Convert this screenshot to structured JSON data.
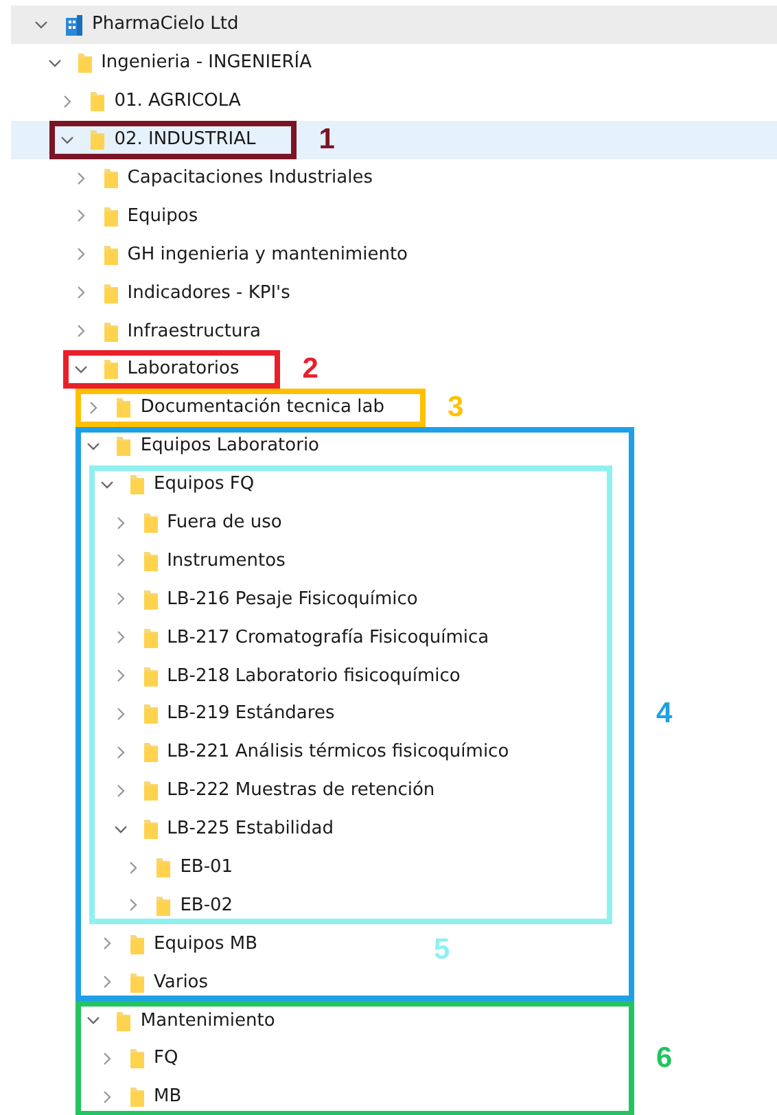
{
  "tree": {
    "label": "PharmaCielo Ltd",
    "kind": "organization",
    "expanded": true,
    "selected": false,
    "children": [
      {
        "label": "Ingenieria - INGENIERÍA",
        "kind": "folder",
        "expanded": true,
        "selected": false,
        "children": [
          {
            "label": "01. AGRICOLA",
            "kind": "folder",
            "expanded": false,
            "selected": false
          },
          {
            "label": "02. INDUSTRIAL",
            "kind": "folder",
            "expanded": true,
            "selected": true,
            "annotation": {
              "label": "1",
              "color": "#7b1526",
              "kind": "row"
            },
            "children": [
              {
                "label": "Capacitaciones Industriales",
                "kind": "folder",
                "expanded": false,
                "selected": false
              },
              {
                "label": "Equipos",
                "kind": "folder",
                "expanded": false,
                "selected": false
              },
              {
                "label": "GH ingenieria y mantenimiento",
                "kind": "folder",
                "expanded": false,
                "selected": false
              },
              {
                "label": "Indicadores - KPI's",
                "kind": "folder",
                "expanded": false,
                "selected": false
              },
              {
                "label": "Infraestructura",
                "kind": "folder",
                "expanded": false,
                "selected": false
              },
              {
                "label": "Laboratorios",
                "kind": "folder",
                "expanded": true,
                "selected": false,
                "annotation": {
                  "label": "2",
                  "color": "#e8202a",
                  "kind": "row"
                },
                "children": [
                  {
                    "label": "Documentación tecnica lab",
                    "kind": "folder",
                    "expanded": false,
                    "selected": false,
                    "annotation": {
                      "label": "3",
                      "color": "#ffc000",
                      "kind": "row"
                    }
                  },
                  {
                    "label": "Equipos Laboratorio",
                    "kind": "folder",
                    "expanded": true,
                    "selected": false,
                    "annotation": {
                      "label": "4",
                      "color": "#1ea0e6",
                      "kind": "branch"
                    },
                    "children": [
                      {
                        "label": "Equipos FQ",
                        "kind": "folder",
                        "expanded": true,
                        "selected": false,
                        "annotation": {
                          "label": "5",
                          "color": "#8ff0f0",
                          "kind": "inset"
                        },
                        "children": [
                          {
                            "label": "Fuera de uso",
                            "kind": "folder",
                            "expanded": false,
                            "selected": false
                          },
                          {
                            "label": "Instrumentos",
                            "kind": "folder",
                            "expanded": false,
                            "selected": false
                          },
                          {
                            "label": "LB-216 Pesaje Fisicoquímico",
                            "kind": "folder",
                            "expanded": false,
                            "selected": false
                          },
                          {
                            "label": "LB-217 Cromatografía Fisicoquímica",
                            "kind": "folder",
                            "expanded": false,
                            "selected": false
                          },
                          {
                            "label": "LB-218 Laboratorio fisicoquímico",
                            "kind": "folder",
                            "expanded": false,
                            "selected": false
                          },
                          {
                            "label": "LB-219 Estándares",
                            "kind": "folder",
                            "expanded": false,
                            "selected": false
                          },
                          {
                            "label": "LB-221 Análisis térmicos fisicoquímico",
                            "kind": "folder",
                            "expanded": false,
                            "selected": false
                          },
                          {
                            "label": "LB-222 Muestras de retención",
                            "kind": "folder",
                            "expanded": false,
                            "selected": false
                          },
                          {
                            "label": "LB-225 Estabilidad",
                            "kind": "folder",
                            "expanded": true,
                            "selected": false,
                            "children": [
                              {
                                "label": "EB-01",
                                "kind": "folder",
                                "expanded": false,
                                "selected": false
                              },
                              {
                                "label": "EB-02",
                                "kind": "folder",
                                "expanded": false,
                                "selected": false
                              }
                            ]
                          }
                        ]
                      },
                      {
                        "label": "Equipos MB",
                        "kind": "folder",
                        "expanded": false,
                        "selected": false
                      },
                      {
                        "label": "Varios",
                        "kind": "folder",
                        "expanded": false,
                        "selected": false
                      }
                    ]
                  },
                  {
                    "label": "Mantenimiento",
                    "kind": "folder",
                    "expanded": true,
                    "selected": false,
                    "annotation": {
                      "label": "6",
                      "color": "#22c55e",
                      "kind": "branch"
                    },
                    "children": [
                      {
                        "label": "FQ",
                        "kind": "folder",
                        "expanded": false,
                        "selected": false
                      },
                      {
                        "label": "MB",
                        "kind": "folder",
                        "expanded": false,
                        "selected": false
                      }
                    ]
                  }
                ]
              }
            ]
          }
        ]
      }
    ]
  }
}
